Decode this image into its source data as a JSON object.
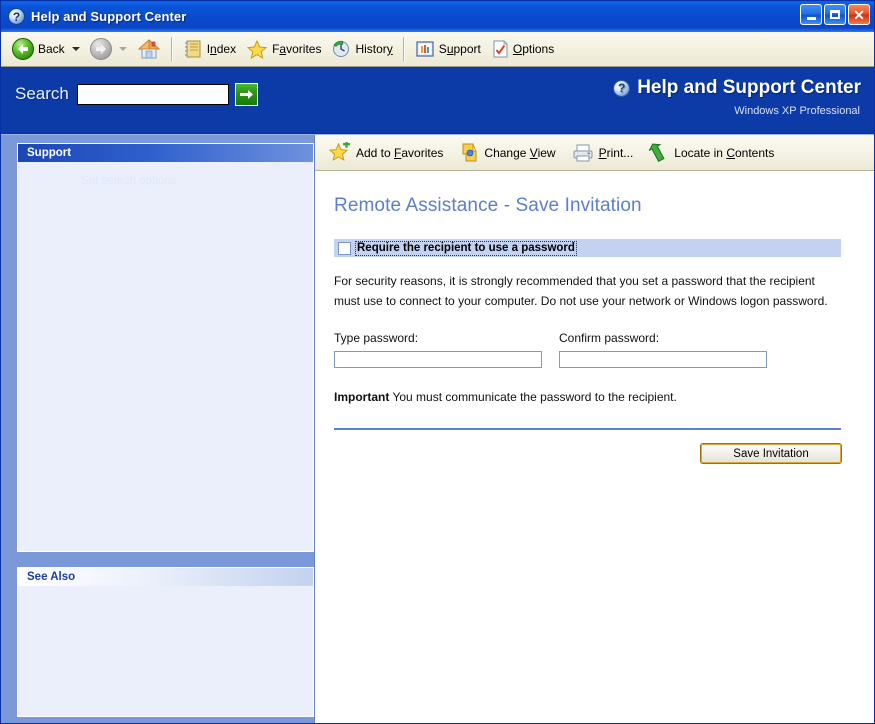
{
  "window": {
    "title": "Help and Support Center",
    "icon": "question-circle-icon",
    "minimize_label": "Minimize",
    "maximize_label": "Maximize",
    "close_label": "Close"
  },
  "toolbar": {
    "back": {
      "label": "Back",
      "icon": "back-arrow-icon",
      "enabled": true
    },
    "forward": {
      "label": "Forward",
      "icon": "forward-arrow-icon",
      "enabled": false
    },
    "home": {
      "label": "Home",
      "icon": "home-icon"
    },
    "items": [
      {
        "label_pre": "I",
        "label_accel": "n",
        "label_post": "dex",
        "label": "Index",
        "icon": "index-book-icon"
      },
      {
        "label_pre": "F",
        "label_accel": "a",
        "label_post": "vorites",
        "label": "Favorites",
        "icon": "star-icon"
      },
      {
        "label_pre": "Histor",
        "label_accel": "y",
        "label_post": "",
        "label": "History",
        "icon": "history-clock-icon"
      },
      {
        "label_pre": "S",
        "label_accel": "u",
        "label_post": "pport",
        "label": "Support",
        "icon": "support-icon"
      },
      {
        "label_pre": "",
        "label_accel": "O",
        "label_post": "ptions",
        "label": "Options",
        "icon": "options-check-icon"
      }
    ]
  },
  "search": {
    "label": "Search",
    "value": "",
    "placeholder": "",
    "go_label": "Go",
    "options_link": "Set search options"
  },
  "banner": {
    "title": "Help and Support Center",
    "subtitle": "Windows XP Professional",
    "icon": "question-circle-icon"
  },
  "sidebar": {
    "panels": [
      {
        "title": "Support",
        "items": []
      },
      {
        "title": "See Also",
        "items": []
      }
    ]
  },
  "content_toolbar": {
    "items": [
      {
        "label_pre": "Add to ",
        "label_accel": "F",
        "label_post": "avorites",
        "label": "Add to Favorites",
        "icon": "star-plus-icon"
      },
      {
        "label_pre": "Change ",
        "label_accel": "V",
        "label_post": "iew",
        "label": "Change View",
        "icon": "change-view-icon"
      },
      {
        "label_pre": "",
        "label_accel": "P",
        "label_post": "rint...",
        "label": "Print...",
        "icon": "printer-icon"
      },
      {
        "label_pre": "Locate in ",
        "label_accel": "C",
        "label_post": "ontents",
        "label": "Locate in Contents",
        "icon": "locate-arrow-icon"
      }
    ]
  },
  "page": {
    "title": "Remote Assistance - Save Invitation",
    "require_password_checkbox": {
      "label": "Require the recipient to use a password",
      "checked": false
    },
    "security_paragraph": "For security reasons, it is strongly recommended that you set a password that the recipient must use to connect to your computer. Do not use your network or Windows logon password.",
    "type_password": {
      "label": "Type password:",
      "value": "",
      "placeholder": ""
    },
    "confirm_password": {
      "label": "Confirm password:",
      "value": "",
      "placeholder": ""
    },
    "important_bold": "Important",
    "important_text": "You must communicate the password to the recipient.",
    "save_button": "Save Invitation"
  },
  "colors": {
    "title_bar_blue": "#0a4ccd",
    "banner_blue": "#0c3ba8",
    "sidebar_blue": "#7b98d8",
    "heading_blue": "#5d7fc9",
    "check_banner_blue": "#c4d2f2",
    "rule_blue": "#5a82d0",
    "button_border_gold": "#d8a43c"
  }
}
